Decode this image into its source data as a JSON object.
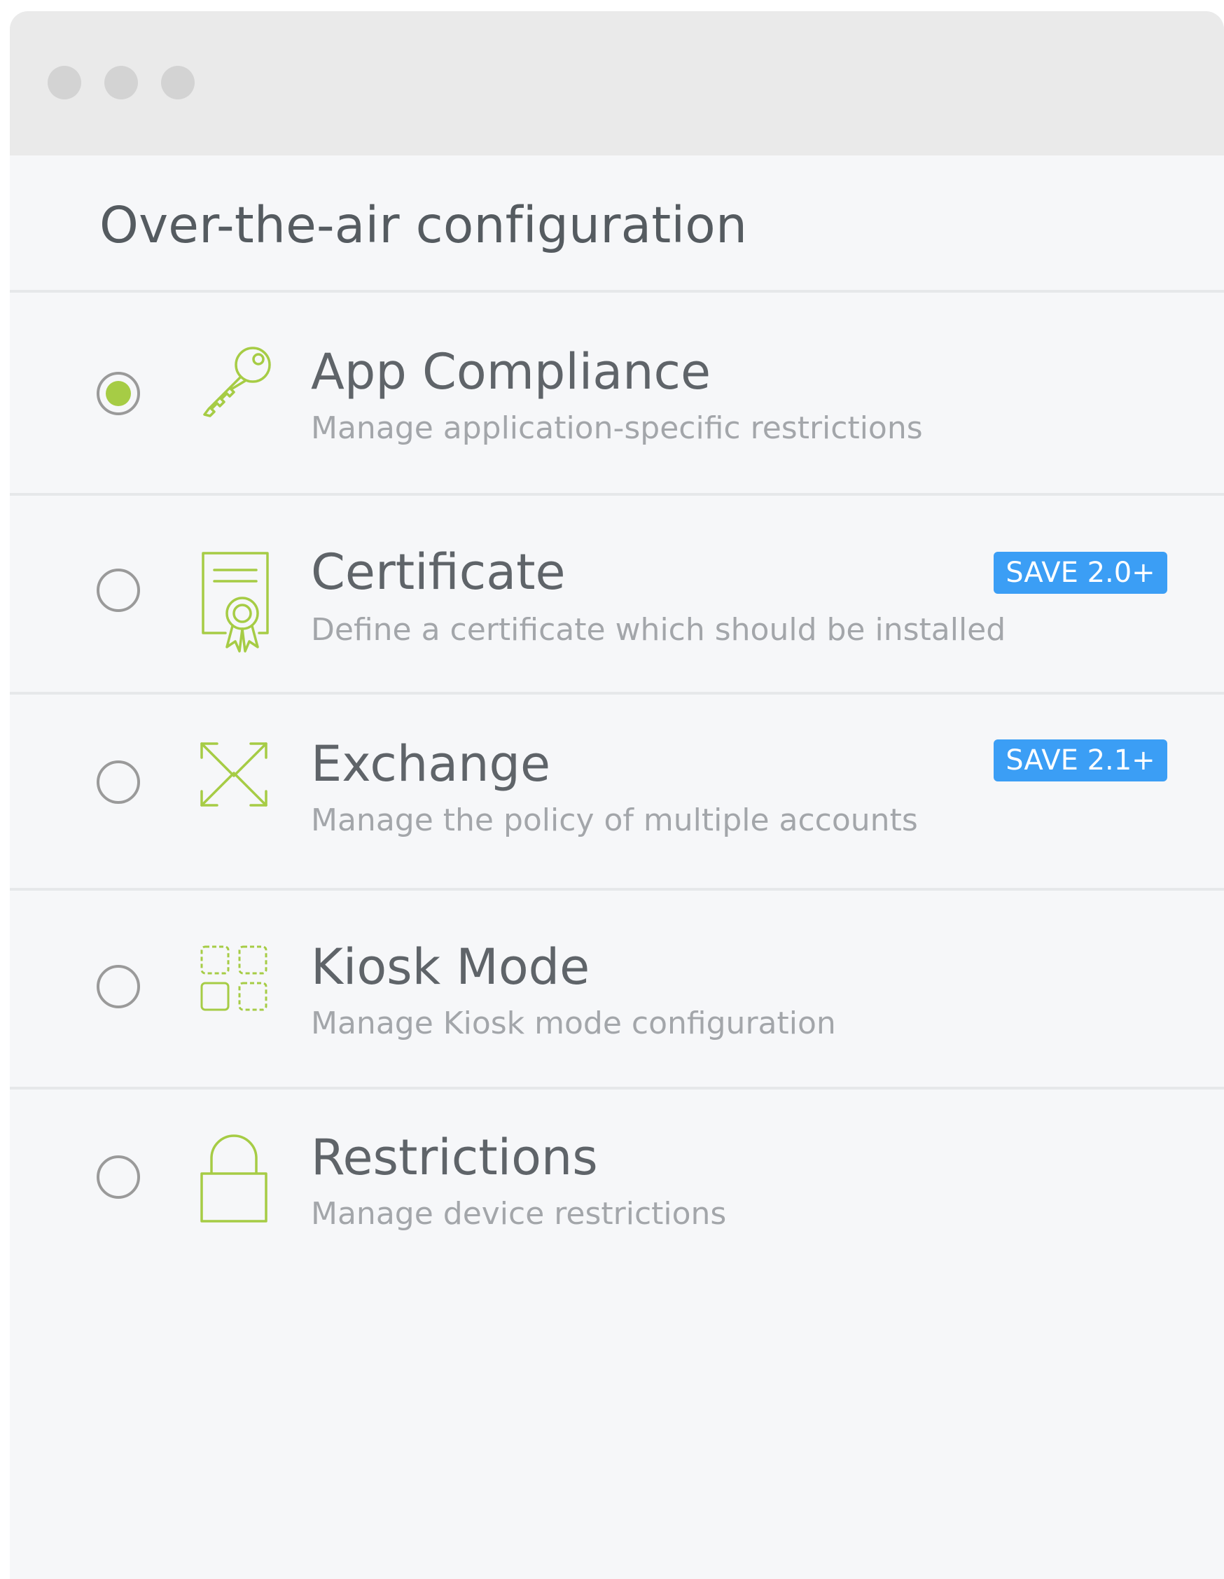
{
  "window": {
    "controls": [
      "close",
      "minimize",
      "maximize"
    ]
  },
  "header": {
    "title": "Over-the-air configuration"
  },
  "items": [
    {
      "title": "App Compliance",
      "description": "Manage application-specific restrictions",
      "icon": "key-icon",
      "selected": true,
      "badge": ""
    },
    {
      "title": "Certificate",
      "description": "Define a certificate which should be installed",
      "icon": "certificate-icon",
      "selected": false,
      "badge": "SAVE 2.0+"
    },
    {
      "title": "Exchange",
      "description": "Manage the policy of multiple accounts",
      "icon": "exchange-icon",
      "selected": false,
      "badge": "SAVE 2.1+"
    },
    {
      "title": "Kiosk Mode",
      "description": "Manage Kiosk mode configuration",
      "icon": "kiosk-grid-icon",
      "selected": false,
      "badge": ""
    },
    {
      "title": "Restrictions",
      "description": "Manage device restrictions",
      "icon": "lock-icon",
      "selected": false,
      "badge": ""
    }
  ],
  "colors": {
    "accent_green": "#a6cc45",
    "badge_blue": "#3b9ef5",
    "titlebar": "#eaeaea",
    "background": "#f6f7f9"
  }
}
